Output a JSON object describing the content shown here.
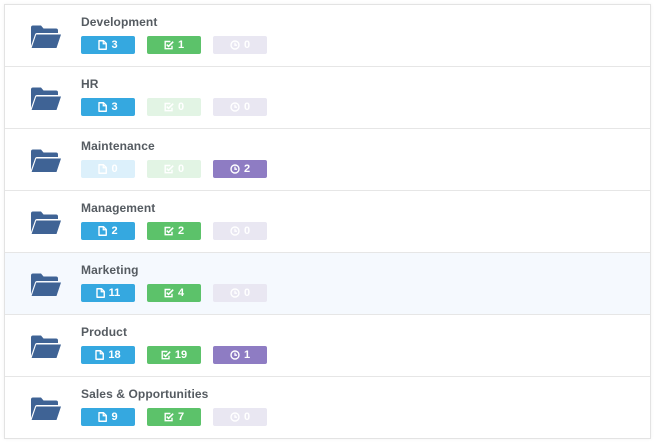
{
  "colors": {
    "folder": "#3f6395",
    "documents": "#35a8e0",
    "tasks": "#5cc26a",
    "timers": "#8e7cc3",
    "documents_zero": "#dcf0fb",
    "tasks_zero": "#e2f4e4",
    "timers_zero": "#e9e7f2",
    "row_highlight": "#f5f9fe"
  },
  "icons": {
    "row": "folder-open-icon",
    "documents": "file-icon",
    "tasks": "checkbox-icon",
    "timers": "clock-icon"
  },
  "folders": [
    {
      "name": "Development",
      "documents": "3",
      "tasks": "1",
      "timers": "0"
    },
    {
      "name": "HR",
      "documents": "3",
      "tasks": "0",
      "timers": "0"
    },
    {
      "name": "Maintenance",
      "documents": "0",
      "tasks": "0",
      "timers": "2"
    },
    {
      "name": "Management",
      "documents": "2",
      "tasks": "2",
      "timers": "0"
    },
    {
      "name": "Marketing",
      "documents": "11",
      "tasks": "4",
      "timers": "0",
      "highlighted": true
    },
    {
      "name": "Product",
      "documents": "18",
      "tasks": "19",
      "timers": "1"
    },
    {
      "name": "Sales & Opportunities",
      "documents": "9",
      "tasks": "7",
      "timers": "0"
    }
  ]
}
